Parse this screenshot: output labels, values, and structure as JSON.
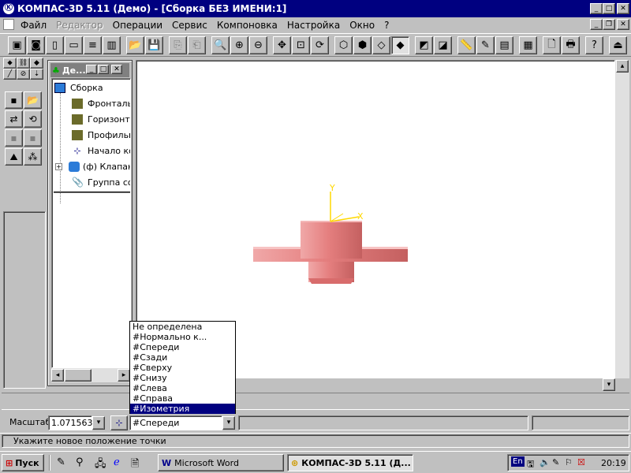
{
  "window": {
    "title": "КОМПАС-3D 5.11 (Демо) - [Сборка БЕЗ ИМЕНИ:1]",
    "minimize_glyph": "_",
    "maximize_glyph": "□",
    "close_glyph": "✕",
    "restore_glyph": "❐"
  },
  "menu": [
    "Файл",
    "Редактор",
    "Операции",
    "Сервис",
    "Компоновка",
    "Настройка",
    "Окно",
    "?"
  ],
  "tree": {
    "title": "Де...",
    "items": [
      "Сборка",
      "Фронтальная",
      "Горизонтальная",
      "Профильная",
      "Начало координат",
      "(ф) Клапан",
      "Группа сопряжений"
    ],
    "expand_glyph": "+"
  },
  "axes": {
    "y": "Y",
    "x": "X",
    "axis_color": "#ffd800"
  },
  "part_color": "#e88a8a",
  "view_list": {
    "options": [
      "Не определена",
      "#Нормально к...",
      "#Спереди",
      "#Сзади",
      "#Сверху",
      "#Снизу",
      "#Слева",
      "#Справа",
      "#Изометрия"
    ],
    "highlighted": "#Изометрия"
  },
  "props": {
    "scale_label": "Масштаб",
    "scale_value": "1.071563",
    "view_value": "#Спереди"
  },
  "status": {
    "hint": "Укажите новое положение точки"
  },
  "taskbar": {
    "start": "Пуск",
    "tasks": [
      "Microsoft Word",
      "КОМПАС-3D 5.11 (Д..."
    ],
    "lang": "En",
    "clock": "20:19"
  }
}
